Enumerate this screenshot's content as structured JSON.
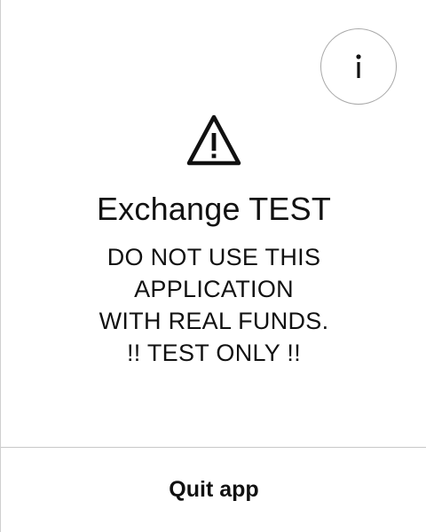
{
  "info_button": {
    "icon": "info-icon",
    "label": "i"
  },
  "warning": {
    "icon": "warning-triangle-icon"
  },
  "title": "Exchange TEST",
  "message_lines": [
    "DO NOT USE THIS",
    "APPLICATION",
    "WITH REAL FUNDS.",
    "!! TEST ONLY !!"
  ],
  "quit_label": "Quit app",
  "colors": {
    "text": "#111111",
    "border": "#a8a8a8",
    "divider": "#c8c8c8",
    "background": "#ffffff"
  }
}
